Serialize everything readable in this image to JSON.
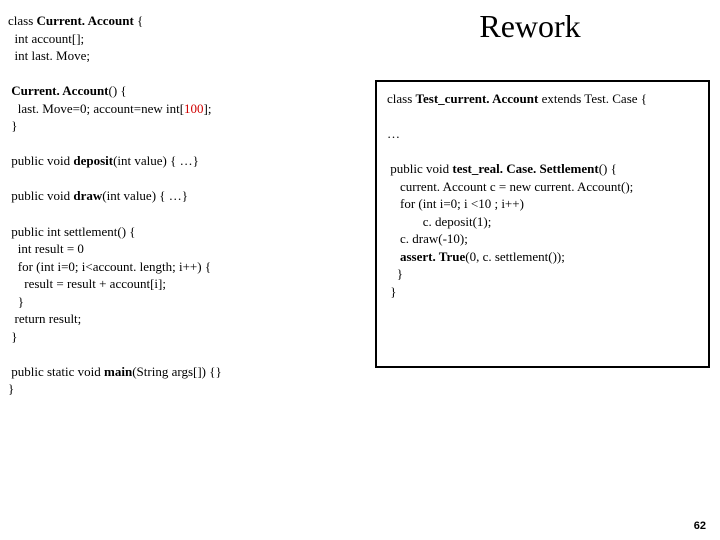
{
  "title": "Rework",
  "pageNumber": "62",
  "left": {
    "l1a": "class ",
    "l1b": "Current. Account",
    "l1c": " {",
    "l2": "  int account[];",
    "l3": "  int last. Move;",
    "l5a": " ",
    "l5b": "Current. Account",
    "l5c": "() {",
    "l6a": "   last. Move=0; account=new int[",
    "l6b": "100",
    "l6c": "];",
    "l7": " }",
    "l9a": " public void ",
    "l9b": "deposit",
    "l9c": "(int value) { …}",
    "l11a": " public void ",
    "l11b": "draw",
    "l11c": "(int value) { …}",
    "l13": " public int settlement() {",
    "l14": "   int result = 0",
    "l15": "   for (int i=0; i<account. length; i++) {",
    "l16": "     result = result + account[i];",
    "l17": "   }",
    "l18": "  return result;",
    "l19": " }",
    "l21a": " public static void ",
    "l21b": "main",
    "l21c": "(String args[]) {}",
    "l22": "}"
  },
  "right": {
    "r1a": "class ",
    "r1b": "Test_current. Account",
    "r1c": " extends Test. Case {",
    "r3": "…",
    "r5a": " public void ",
    "r5b": "test_real. Case. Settlement",
    "r5c": "() {",
    "r6": "    current. Account c = new current. Account();",
    "r7": "    for (int i=0; i <10 ; i++)",
    "r8": "           c. deposit(1);",
    "r9": "    c. draw(-10);",
    "r10a": "    ",
    "r10b": "assert. True",
    "r10c": "(0, c. settlement());",
    "r11": "   }",
    "r12": " }"
  }
}
